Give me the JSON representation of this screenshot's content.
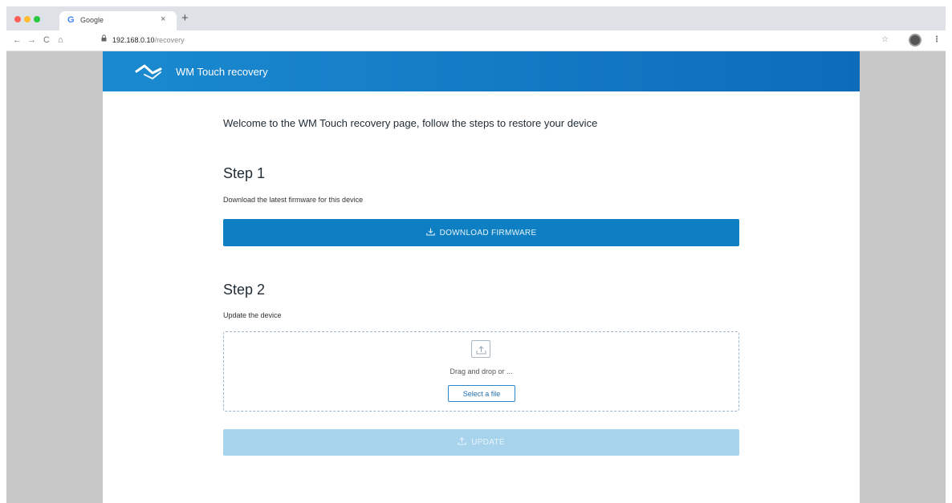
{
  "browser": {
    "tab": {
      "title": "Google",
      "favicon": "G",
      "close": "×"
    },
    "new_tab": "+",
    "nav": {
      "back": "←",
      "forward": "→",
      "reload": "C",
      "home": "⌂"
    },
    "url": {
      "host": "192.168.0.10",
      "path": "/recovery"
    },
    "icons": [
      "lock-icon",
      "star-icon",
      "avatar",
      "menu-dots-icon"
    ]
  },
  "header": {
    "title": "WM Touch recovery",
    "color": "#1686cc"
  },
  "main": {
    "welcome": "Welcome to the WM Touch recovery page, follow the steps to restore your device",
    "step1": {
      "title": "Step 1",
      "description": "Download  the latest firmware for this device",
      "button": "DOWNLOAD FIRMWARE",
      "button_icon": "download-icon"
    },
    "step2": {
      "title": "Step 2",
      "description": "Update the device",
      "drop_text": "Drag and drop or ...",
      "select_button": "Select a file",
      "update_button": "UPDATE",
      "update_icon": "upload-icon"
    }
  },
  "colors": {
    "primary": "#0d7fc2",
    "disabled": "#a7d3ec"
  }
}
